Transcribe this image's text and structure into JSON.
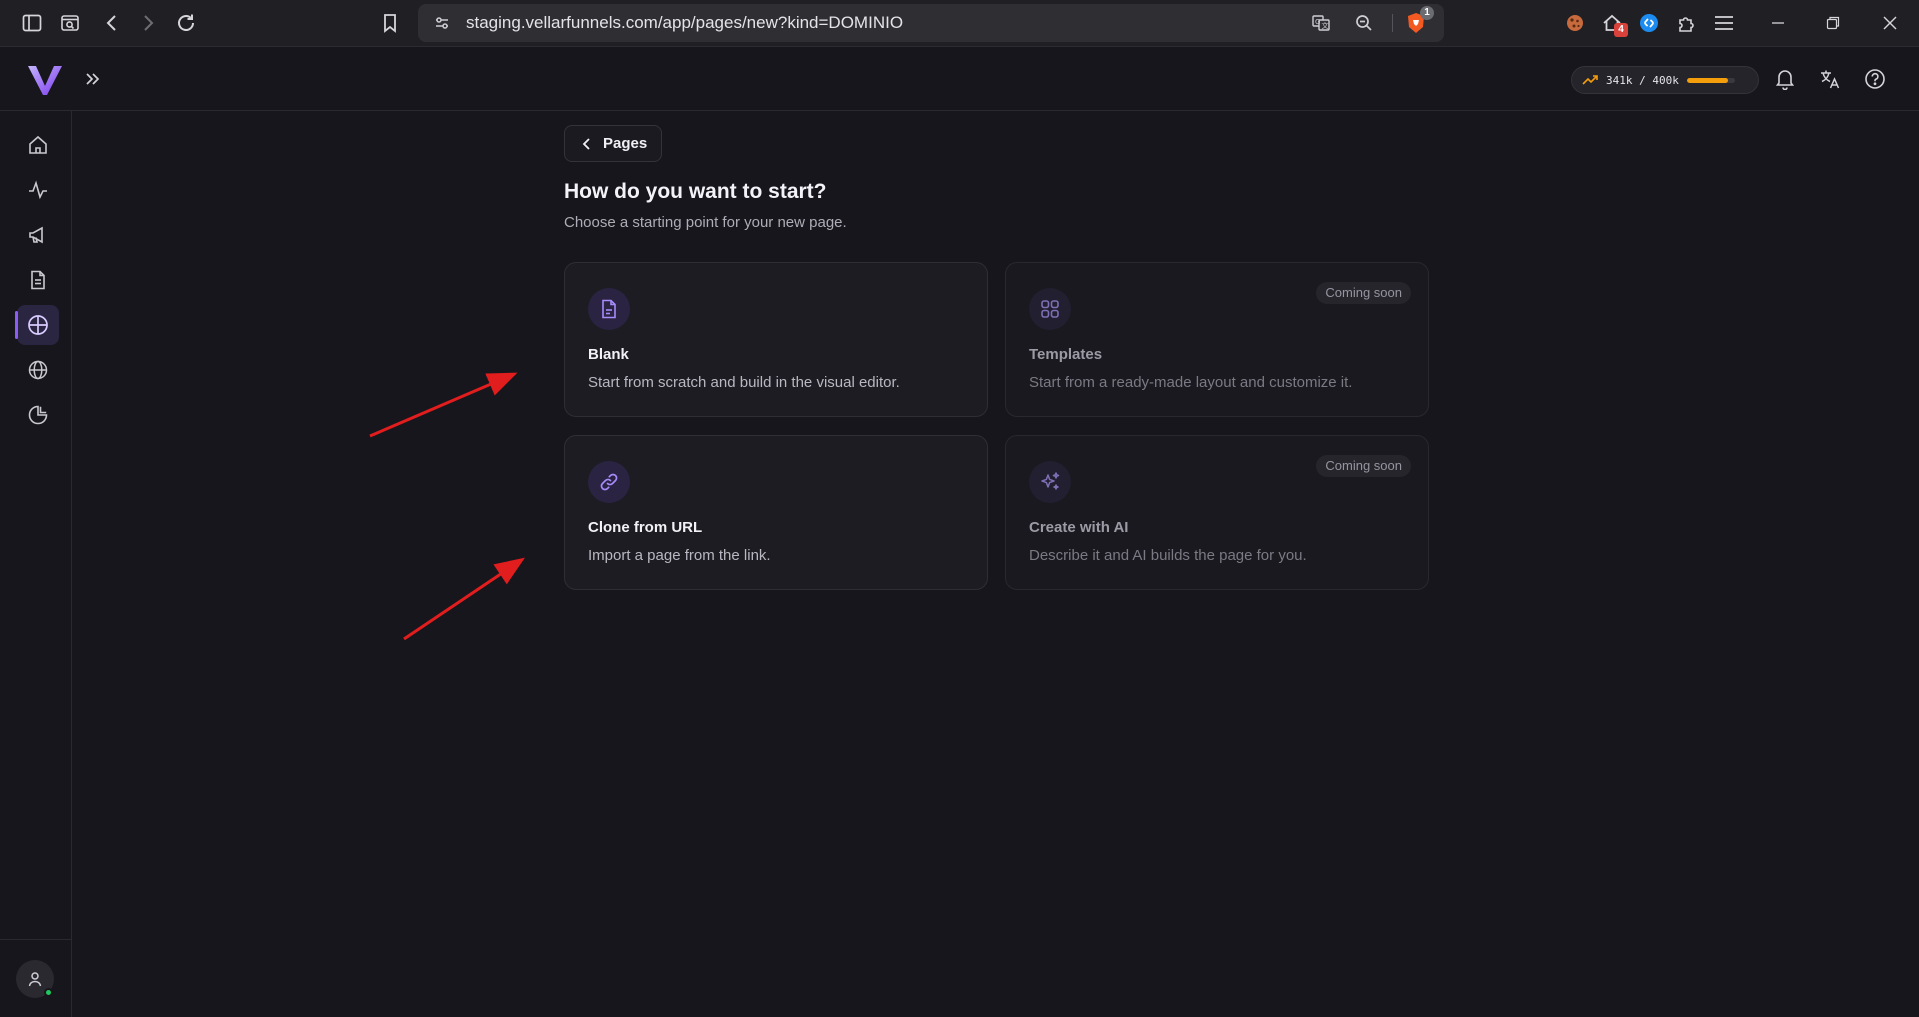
{
  "browser": {
    "url": "staging.vellarfunnels.com/app/pages/new?kind=DOMINIO",
    "brave_badge": "1",
    "extension_badge": "4",
    "icons": [
      "sidebar-toggle-icon",
      "tab-search-icon",
      "back-icon",
      "forward-icon",
      "reload-icon",
      "bookmark-icon",
      "site-settings-icon",
      "translate-icon",
      "zoom-icon",
      "brave-shield-icon",
      "cookie-icon",
      "extension-home-icon",
      "shazam-icon",
      "extensions-icon",
      "menu-icon",
      "minimize-icon",
      "restore-icon",
      "close-icon"
    ]
  },
  "header": {
    "usage_text": "341k / 400k",
    "usage_fraction": 0.8525,
    "usage_color": "#f59e0b",
    "icons": [
      "logo-icon",
      "expand-icon",
      "trend-icon",
      "bell-icon",
      "language-icon",
      "help-icon"
    ]
  },
  "sidebar": {
    "items": [
      {
        "name": "home",
        "icon": "home-icon"
      },
      {
        "name": "activity",
        "icon": "activity-icon"
      },
      {
        "name": "campaigns",
        "icon": "megaphone-icon"
      },
      {
        "name": "documents",
        "icon": "document-icon"
      },
      {
        "name": "pages",
        "icon": "crosshair-icon",
        "active": true
      },
      {
        "name": "domains",
        "icon": "globe-icon"
      },
      {
        "name": "reports",
        "icon": "pie-chart-icon"
      }
    ],
    "accent": "#8b5cf6"
  },
  "main": {
    "back_label": "Pages",
    "title": "How do you want to start?",
    "subtitle": "Choose a starting point for your new page.",
    "cards": [
      {
        "title": "Blank",
        "description": "Start from scratch and build in the visual editor.",
        "icon": "document-icon",
        "badge": ""
      },
      {
        "title": "Templates",
        "description": "Start from a ready-made layout and customize it.",
        "icon": "grid-icon",
        "badge": "Coming soon"
      },
      {
        "title": "Clone from URL",
        "description": "Import a page from the link.",
        "icon": "link-icon",
        "badge": ""
      },
      {
        "title": "Create with AI",
        "description": "Describe it and AI builds the page for you.",
        "icon": "sparkles-icon",
        "badge": "Coming soon"
      }
    ]
  },
  "annotation_color": "#e11d1d"
}
